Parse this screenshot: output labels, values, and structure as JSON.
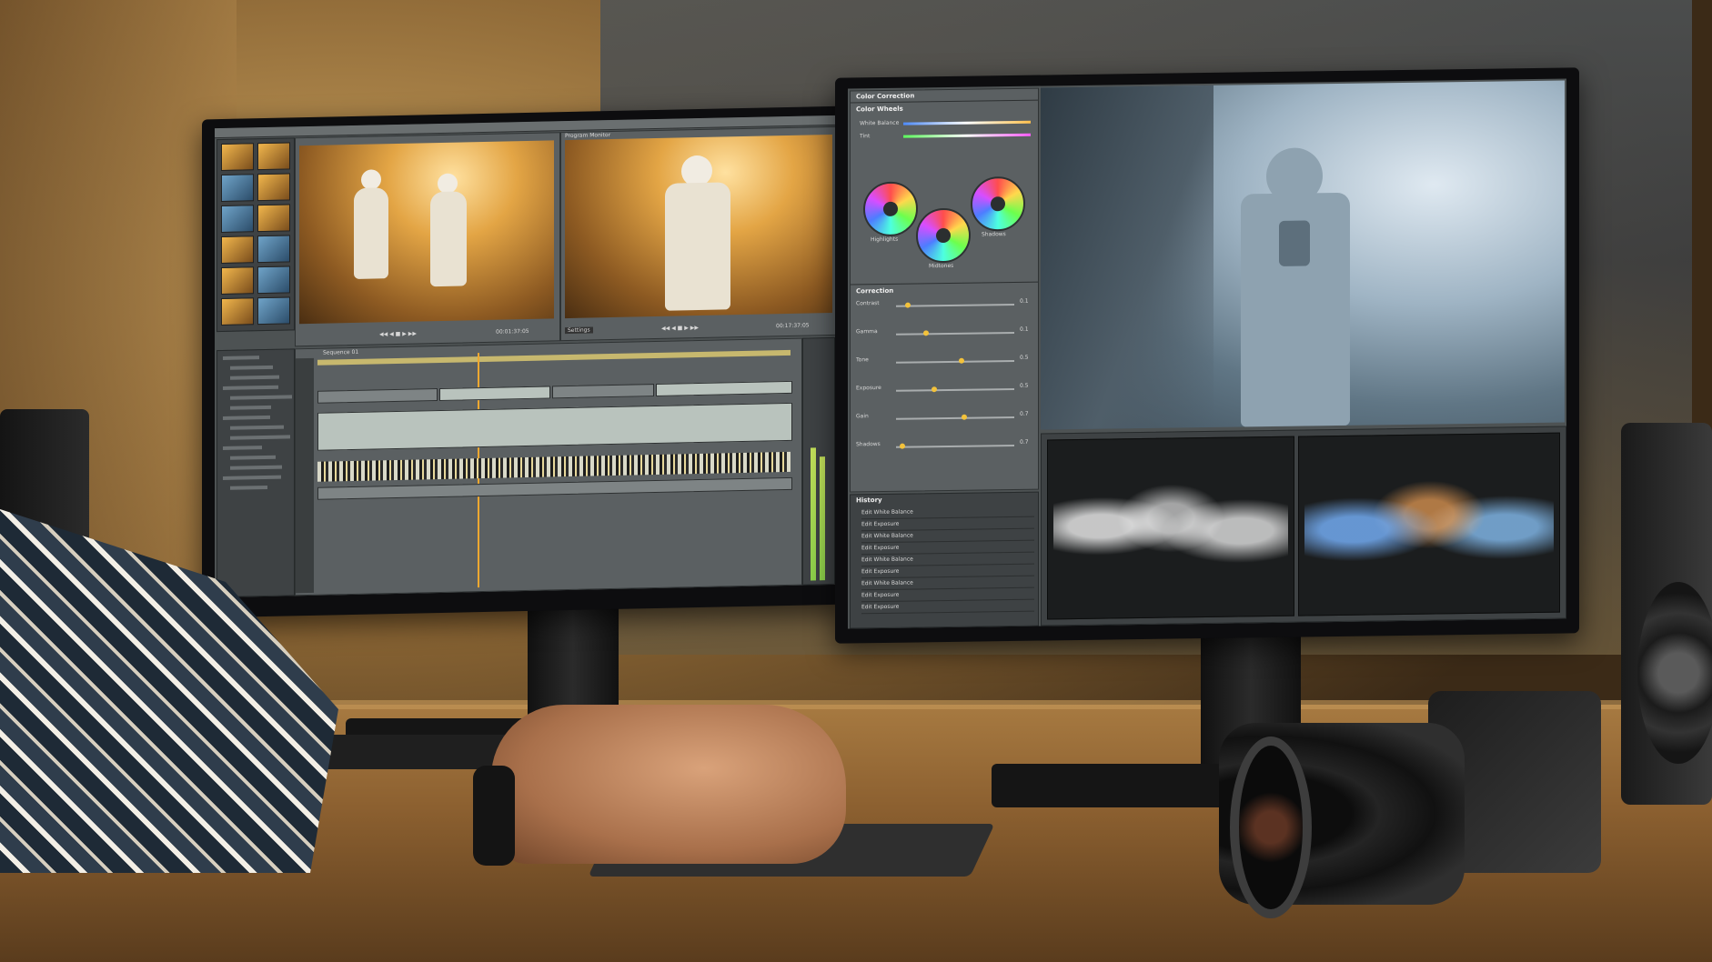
{
  "left_monitor": {
    "source_viewer": {
      "timecode": "00:01:37:05"
    },
    "program_viewer": {
      "title": "Program Monitor",
      "settings_label": "Settings",
      "timecode": "00:17:37:05"
    },
    "timeline": {
      "title": "Sequence 01"
    },
    "thumbnails": [
      "warm",
      "warm",
      "cool",
      "warm",
      "cool",
      "warm",
      "warm",
      "cool",
      "warm",
      "cool",
      "warm",
      "cool"
    ]
  },
  "right_monitor": {
    "panel_title": "Color Correction",
    "color_wheels": {
      "heading": "Color Wheels",
      "white_balance_label": "White Balance",
      "tint_label": "Tint",
      "wheels": [
        {
          "label": "Highlights"
        },
        {
          "label": "Midtones"
        },
        {
          "label": "Shadows"
        }
      ]
    },
    "corrections": {
      "heading": "Correction",
      "sliders": [
        {
          "label": "Contrast",
          "value": "0.1",
          "level": 0.1
        },
        {
          "label": "Gamma",
          "value": "0.1",
          "level": 0.25
        },
        {
          "label": "Tone",
          "value": "0.5",
          "level": 0.55
        },
        {
          "label": "Exposure",
          "value": "0.5",
          "level": 0.32
        },
        {
          "label": "Gain",
          "value": "0.7",
          "level": 0.58
        },
        {
          "label": "Shadows",
          "value": "0.7",
          "level": 0.05
        }
      ]
    },
    "history": {
      "heading": "History",
      "items": [
        "Edit White Balance",
        "Edit Exposure",
        "Edit White Balance",
        "Edit Exposure",
        "Edit White Balance",
        "Edit Exposure",
        "Edit White Balance",
        "Edit Exposure",
        "Edit Exposure"
      ]
    }
  },
  "colors": {
    "screen_bg": "#4d5253",
    "knob": "#f3c23b",
    "meter": "#8bd04a",
    "desk": "#a77a41"
  }
}
